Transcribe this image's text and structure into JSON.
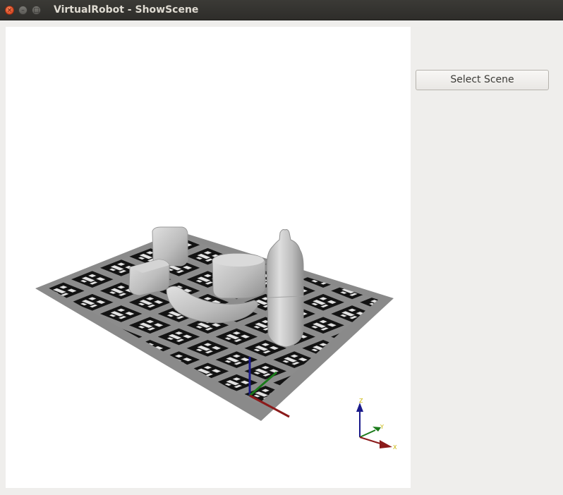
{
  "window": {
    "title": "VirtualRobot - ShowScene",
    "close_glyph": "×",
    "minimize_glyph": "–",
    "maximize_glyph": "□"
  },
  "sidebar": {
    "select_scene_label": "Select Scene"
  },
  "viewport": {
    "background": "#ffffff",
    "axis_gizmo": {
      "z_label": "Z",
      "y_label": "Y",
      "x_label": "X",
      "x_color": "#8b1a1a",
      "y_color": "#1a7a1a",
      "z_color": "#1a1a8b"
    }
  },
  "colors": {
    "titlebar": "#35342f",
    "close_button": "#e0522b",
    "window_background": "#efeeec"
  }
}
